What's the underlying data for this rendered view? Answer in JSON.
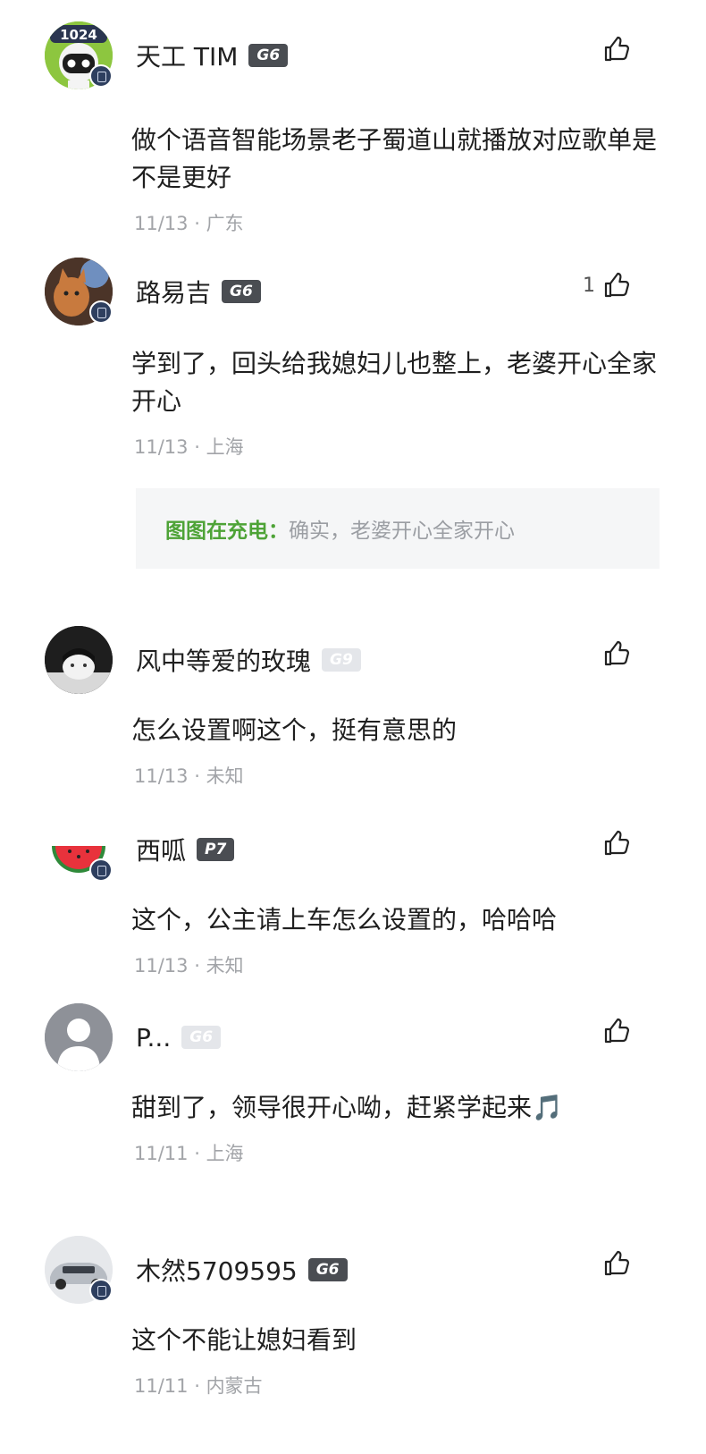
{
  "comments": [
    {
      "name": "天工 TIM",
      "badge": "G6",
      "content": "做个语音智能场景老子蜀道山就播放对应歌单是不是更好",
      "date": "11/13",
      "location": "广东",
      "likes": ""
    },
    {
      "name": "路易吉",
      "badge": "G6",
      "content": "学到了，回头给我媳妇儿也整上，老婆开心全家开心",
      "date": "11/13",
      "location": "上海",
      "likes": "1",
      "reply": {
        "author": "图图在充电：",
        "text": "确实，老婆开心全家开心"
      }
    },
    {
      "name": "风中等爱的玫瑰",
      "badge": "G9",
      "content": "怎么设置啊这个，挺有意思的",
      "date": "11/13",
      "location": "未知",
      "likes": ""
    },
    {
      "name": "西呱",
      "badge": "P7",
      "content": "这个，公主请上车怎么设置的，哈哈哈",
      "date": "11/13",
      "location": "未知",
      "likes": ""
    },
    {
      "name": "P...",
      "badge": "G6",
      "content": "甜到了，领导很开心呦，赶紧学起来🎵",
      "date": "11/11",
      "location": "上海",
      "likes": ""
    },
    {
      "name": "木然5709595",
      "badge": "G6",
      "content": "这个不能让媳妇看到",
      "date": "11/11",
      "location": "内蒙古",
      "likes": ""
    }
  ],
  "separator": " · ",
  "avatar1_text": "1024"
}
